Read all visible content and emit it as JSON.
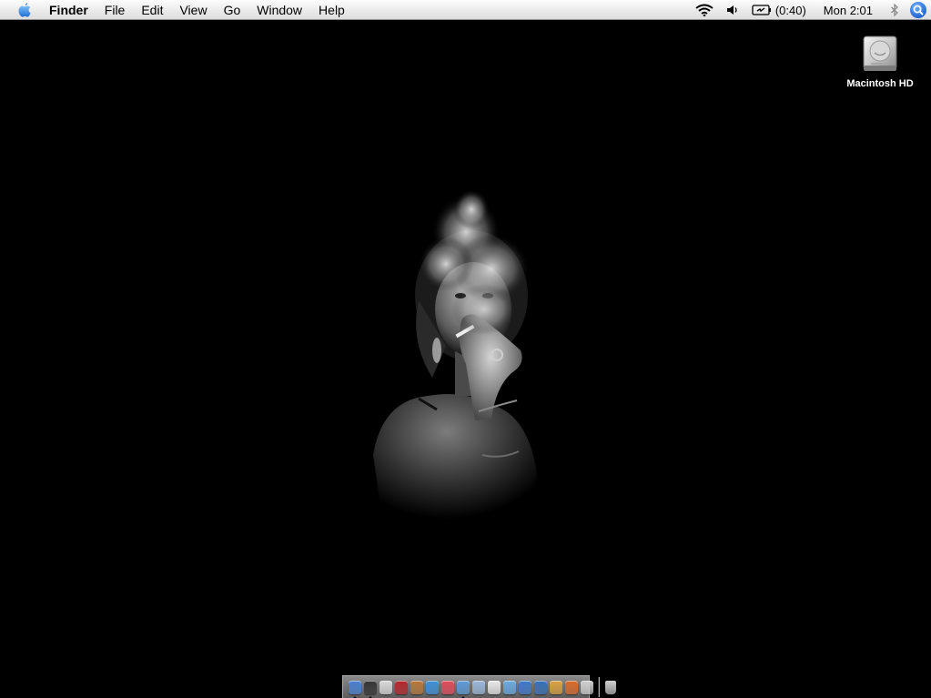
{
  "menubar": {
    "app_name": "Finder",
    "menus": [
      "File",
      "Edit",
      "View",
      "Go",
      "Window",
      "Help"
    ],
    "battery_time": "(0:40)",
    "clock": "Mon 2:01"
  },
  "desktop": {
    "hd_label": "Macintosh HD"
  },
  "dock": {
    "apps": [
      {
        "icon": "finder-icon",
        "color": "#4a7fd1",
        "running": true
      },
      {
        "icon": "dashboard-icon",
        "color": "#333333",
        "running": true
      },
      {
        "icon": "textedit-icon",
        "color": "#d8d8d8",
        "running": false
      },
      {
        "icon": "pdf-reader-icon",
        "color": "#b3262a",
        "running": false
      },
      {
        "icon": "photo-app-icon",
        "color": "#b8763a",
        "running": false
      },
      {
        "icon": "chat-app-icon",
        "color": "#3b8fd6",
        "running": false
      },
      {
        "icon": "media-app-icon",
        "color": "#e04a5a",
        "running": false
      },
      {
        "icon": "browser-icon",
        "color": "#5a9ad8",
        "running": true
      },
      {
        "icon": "mail-icon",
        "color": "#9ab6d8",
        "running": false
      },
      {
        "icon": "calendar-icon",
        "color": "#e8e8e8",
        "running": false
      },
      {
        "icon": "itunes-icon",
        "color": "#6aa8e0",
        "running": false
      },
      {
        "icon": "ical-icon",
        "color": "#3d78c9",
        "running": false
      },
      {
        "icon": "imovie-icon",
        "color": "#3470b8",
        "running": false
      },
      {
        "icon": "iphoto-icon",
        "color": "#d8a040",
        "running": false
      },
      {
        "icon": "office-app-icon",
        "color": "#d86a2a",
        "running": false
      },
      {
        "icon": "preview-icon",
        "color": "#cfcfcf",
        "running": false
      }
    ],
    "trash_icon": "trash-icon"
  }
}
